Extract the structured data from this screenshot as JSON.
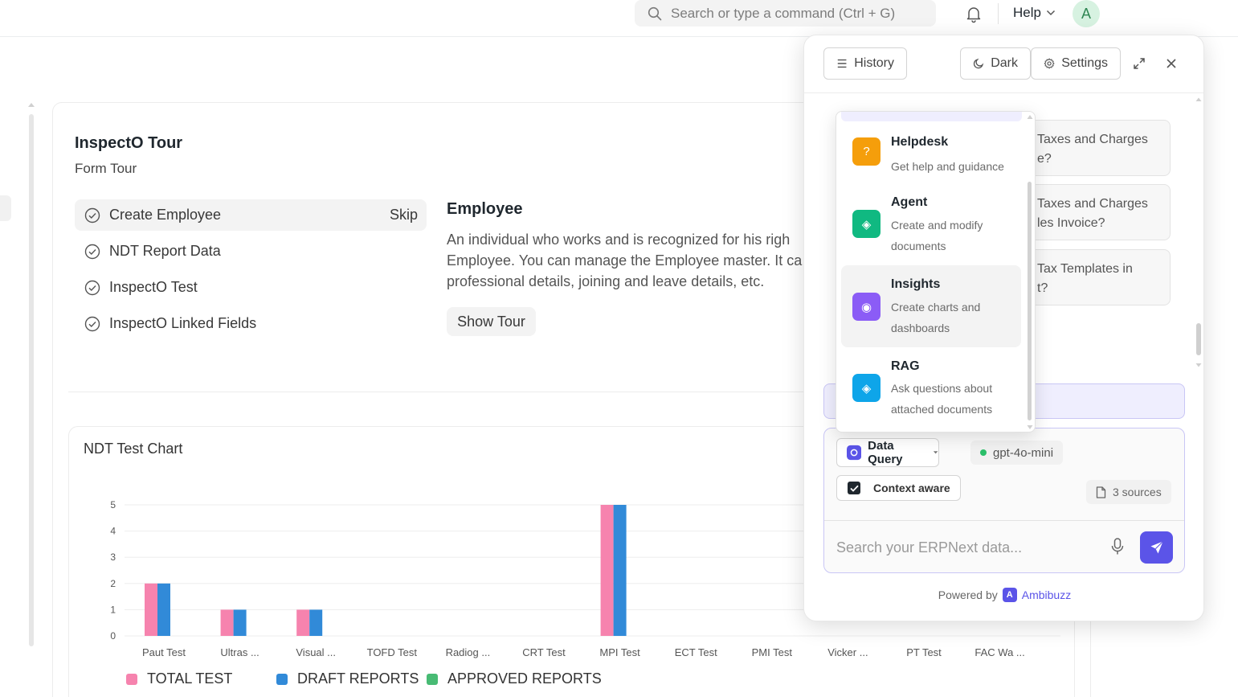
{
  "navbar": {
    "search_placeholder": "Search or type a command (Ctrl + G)",
    "help_label": "Help",
    "avatar_initial": "A"
  },
  "tour": {
    "title": "InspectO Tour",
    "subtitle": "Form Tour",
    "steps": [
      {
        "label": "Create Employee",
        "active": true
      },
      {
        "label": "NDT Report Data",
        "active": false
      },
      {
        "label": "InspectO Test",
        "active": false
      },
      {
        "label": "InspectO Linked Fields",
        "active": false
      }
    ],
    "skip_label": "Skip",
    "detail_title": "Employee",
    "detail_lines": [
      "An individual who works and is recognized for his righ",
      "Employee. You can manage the Employee master. It ca",
      "professional details, joining and leave details, etc."
    ],
    "show_tour_label": "Show Tour"
  },
  "chart": {
    "title": "NDT Test Chart"
  },
  "chart_data": {
    "type": "bar",
    "categories": [
      "Paut Test",
      "Ultras ...",
      "Visual ...",
      "TOFD Test",
      "Radiog ...",
      "CRT Test",
      "MPI Test",
      "ECT Test",
      "PMI Test",
      "Vicker ...",
      "PT Test",
      "FAC Wa ..."
    ],
    "series": [
      {
        "name": "TOTAL TEST",
        "values": [
          2,
          1,
          1,
          0,
          0,
          0,
          5,
          0,
          0,
          0,
          0,
          0
        ],
        "color": "#f683ae"
      },
      {
        "name": "DRAFT REPORTS",
        "values": [
          2,
          1,
          1,
          0,
          0,
          0,
          5,
          0,
          0,
          0,
          0,
          0
        ],
        "color": "#318ad8"
      },
      {
        "name": "APPROVED REPORTS",
        "values": [
          0,
          0,
          0,
          0,
          0,
          0,
          0,
          0,
          0,
          0,
          0,
          0
        ],
        "color": "#48bb74"
      }
    ],
    "y_ticks": [
      0,
      1,
      2,
      3,
      4,
      5
    ],
    "ylim": [
      0,
      5
    ],
    "grid": true,
    "legend_position": "bottom-left"
  },
  "chat_panel": {
    "history_label": "History",
    "dark_label": "Dark",
    "settings_label": "Settings",
    "suggestions": [
      [
        "Taxes and Charges",
        "e?"
      ],
      [
        "Taxes and Charges",
        "les Invoice?"
      ],
      [
        "Tax Templates in",
        "t?"
      ]
    ],
    "mode_label": "Data Query",
    "model_label": "gpt-4o-mini",
    "context_label": "Context aware",
    "sources_label": "3 sources",
    "input_placeholder": "Search your ERPNext data...",
    "powered_by": "Powered by",
    "brand_logo_letter": "A",
    "brand_name": "Ambibuzz"
  },
  "mode_dropdown": {
    "items": [
      {
        "label": "Helpdesk",
        "desc": "Get help and guidance",
        "icon": "question-icon",
        "color": "#f59e0b",
        "glyph": "?"
      },
      {
        "label": "Agent",
        "desc": "Create and modify documents",
        "icon": "agent-icon",
        "color": "#10b981",
        "glyph": "◈"
      },
      {
        "label": "Insights",
        "desc": "Create charts and dashboards",
        "icon": "insights-icon",
        "color": "#8b5cf6",
        "glyph": "◉"
      },
      {
        "label": "RAG",
        "desc": "Ask questions about attached documents",
        "icon": "rag-icon",
        "color": "#0ea5e9",
        "glyph": "◈"
      }
    ]
  }
}
